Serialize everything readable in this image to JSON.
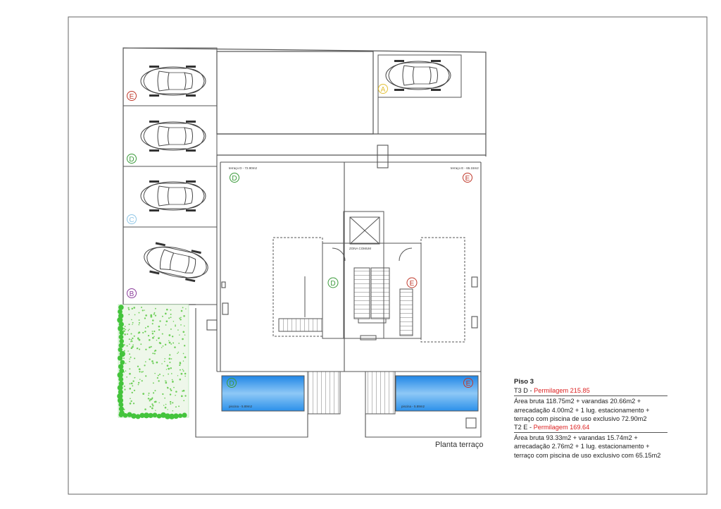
{
  "drawing": {
    "title": "Planta terraço",
    "colors": {
      "line": "#555555",
      "pool": "#3aa0f0",
      "greenery": "#3fbf3a",
      "mark_A": "#e3c23a",
      "mark_B": "#8a3c9a",
      "mark_C": "#8fc6e6",
      "mark_D": "#3a9a3a",
      "mark_E": "#c0392b"
    }
  },
  "parking": {
    "spaces": [
      {
        "mark": "E"
      },
      {
        "mark": "D"
      },
      {
        "mark": "C"
      },
      {
        "mark": "B"
      },
      {
        "mark": "A"
      }
    ]
  },
  "terraces": {
    "d": {
      "label": "terraço D - 72.90m2",
      "mark": "D"
    },
    "e": {
      "label": "terraço E - 65.15m2",
      "mark": "E"
    }
  },
  "core": {
    "label": "ZONA COMUM",
    "mark_d": "D",
    "mark_e": "E"
  },
  "pools": {
    "d": {
      "label": "piscina - 5.89m2",
      "mark": "D"
    },
    "e": {
      "label": "piscina - 5.89m2",
      "mark": "E"
    }
  },
  "legend": {
    "floor": "Piso 3",
    "units": [
      {
        "name": "T3 D - ",
        "permilagem": "Permilagem 215.85",
        "lines": [
          "Área bruta 118.75m2 + varandas 20.66m2 +",
          "arrecadação 4.00m2 + 1 lug. estacionamento +",
          "terraço com piscina de uso exclusivo 72.90m2"
        ]
      },
      {
        "name": "T2 E - ",
        "permilagem": "Permilagem 169.64",
        "lines": [
          "Área bruta 93.33m2 + varandas 15.74m2 +",
          "arrecadação 2.76m2 + 1 lug. estacionamento +",
          "terraço com piscina de uso exclusivo com 65.15m2"
        ]
      }
    ]
  }
}
